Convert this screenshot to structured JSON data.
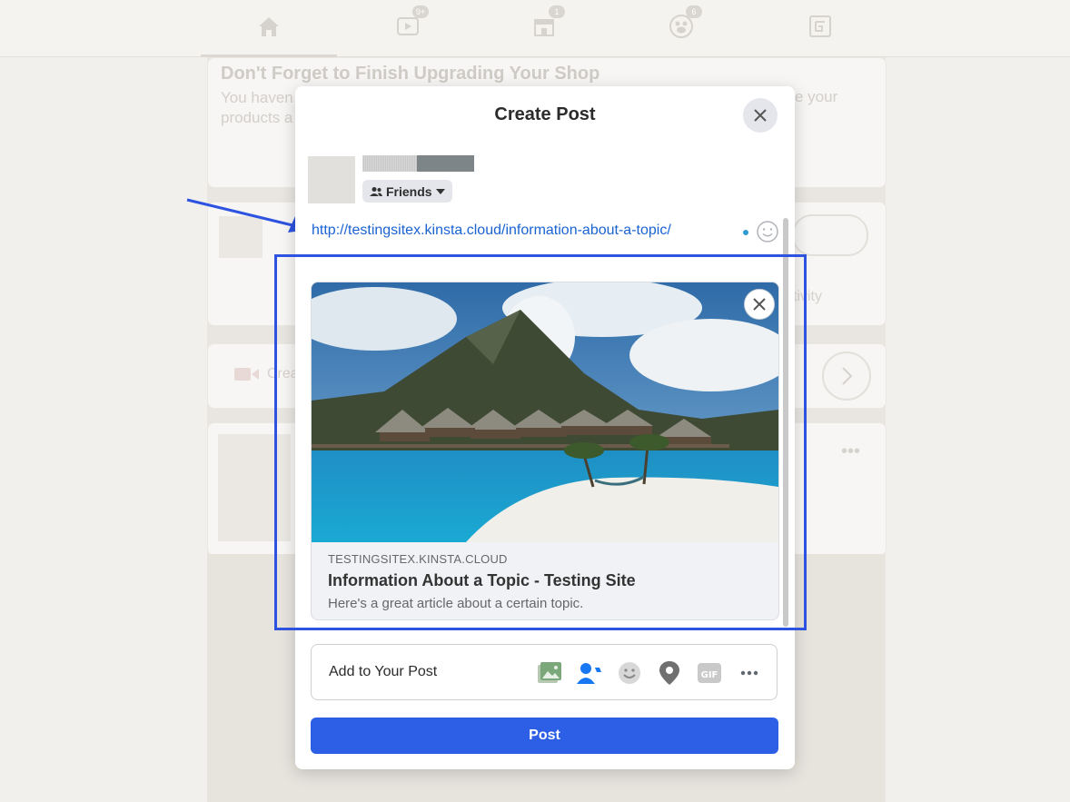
{
  "topnav": {
    "badges": {
      "watch": "9+",
      "marketplace": "1",
      "groups": "6"
    }
  },
  "background": {
    "shop_title": "Don't Forget to Finish Upgrading Your Shop",
    "shop_text_1": "You haven",
    "shop_text_2": "products a",
    "shop_text_right": "e your",
    "activity_fragment": "tivity",
    "create_fragment": "Crea"
  },
  "modal": {
    "title": "Create Post",
    "audience_label": "Friends",
    "post_text": "http://testingsitex.kinsta.cloud/information-about-a-topic/",
    "preview": {
      "domain": "TESTINGSITEX.KINSTA.CLOUD",
      "title": "Information About a Topic - Testing Site",
      "description": "Here's a great article about a certain topic."
    },
    "add_to_post_label": "Add to Your Post",
    "add_icons": [
      "photo-video-icon",
      "tag-people-icon",
      "feeling-icon",
      "check-in-icon",
      "gif-icon",
      "more-icon"
    ],
    "post_button": "Post"
  },
  "colors": {
    "accent": "#2d5fe6",
    "link": "#1a63d1",
    "annotation": "#2d53e0"
  }
}
